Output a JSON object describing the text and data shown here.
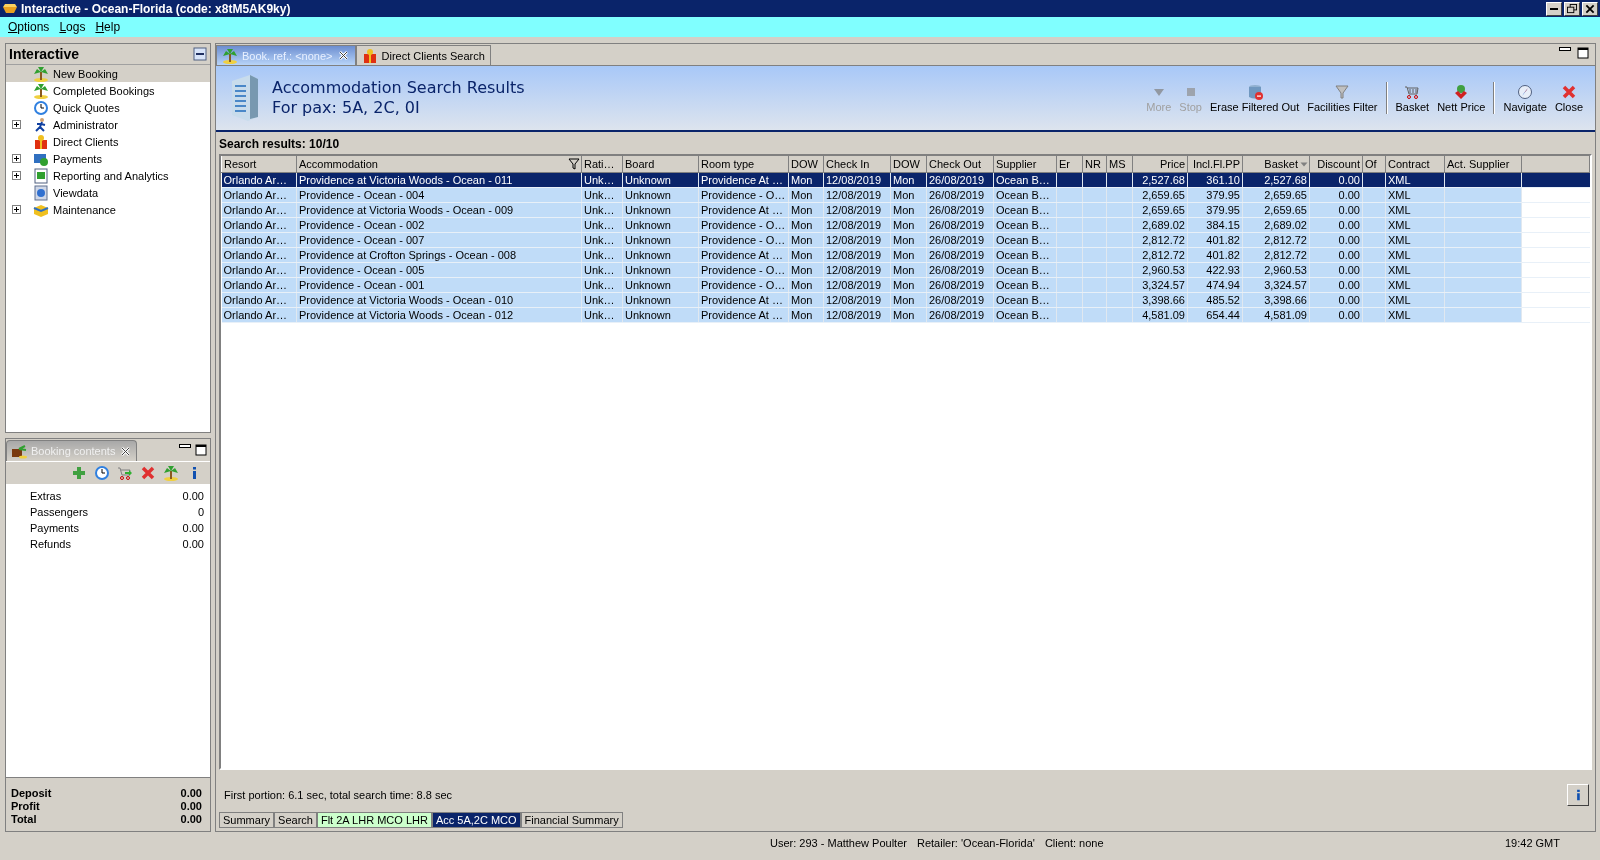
{
  "window": {
    "title": "Interactive - Ocean-Florida (code: x8tM5AK9ky)"
  },
  "menu": [
    {
      "label": "Options"
    },
    {
      "label": "Logs"
    },
    {
      "label": "Help"
    }
  ],
  "navigator": {
    "title": "Interactive",
    "items": [
      {
        "label": "New Booking",
        "selected": true,
        "expandable": false
      },
      {
        "label": "Completed Bookings",
        "selected": false,
        "expandable": false
      },
      {
        "label": "Quick Quotes",
        "selected": false,
        "expandable": false
      },
      {
        "label": "Administrator",
        "selected": false,
        "expandable": true
      },
      {
        "label": "Direct Clients",
        "selected": false,
        "expandable": false
      },
      {
        "label": "Payments",
        "selected": false,
        "expandable": true
      },
      {
        "label": "Reporting and Analytics",
        "selected": false,
        "expandable": true
      },
      {
        "label": "Viewdata",
        "selected": false,
        "expandable": false
      },
      {
        "label": "Maintenance",
        "selected": false,
        "expandable": true
      }
    ]
  },
  "booking_panel": {
    "tab": "Booking contents",
    "lines": [
      {
        "label": "Extras",
        "value": "0.00"
      },
      {
        "label": "Passengers",
        "value": "0"
      },
      {
        "label": "Payments",
        "value": "0.00"
      },
      {
        "label": "Refunds",
        "value": "0.00"
      }
    ],
    "totals": [
      {
        "label": "Deposit",
        "value": "0.00"
      },
      {
        "label": "Profit",
        "value": "0.00"
      },
      {
        "label": "Total",
        "value": "0.00"
      }
    ]
  },
  "tabs": [
    {
      "label": "Book. ref.: <none>",
      "selected": true,
      "closable": true
    },
    {
      "label": "Direct Clients Search",
      "selected": false,
      "closable": false
    }
  ],
  "header": {
    "title": "Accommodation Search Results",
    "subtitle": "For pax: 5A, 2C, 0I"
  },
  "toolbar": {
    "groups": [
      [
        {
          "label": "More",
          "disabled": true
        },
        {
          "label": "Stop",
          "disabled": true
        },
        {
          "label": "Erase Filtered Out",
          "disabled": false
        },
        {
          "label": "Facilities Filter",
          "disabled": false
        }
      ],
      [
        {
          "label": "Basket",
          "disabled": false
        },
        {
          "label": "Nett Price",
          "disabled": false
        }
      ],
      [
        {
          "label": "Navigate",
          "disabled": false
        },
        {
          "label": "Close",
          "disabled": false
        }
      ]
    ]
  },
  "results_label": "Search results: 10/10",
  "table": {
    "columns": [
      {
        "label": "Resort",
        "kind": "text",
        "filtered": false,
        "sorted": false
      },
      {
        "label": "Accommodation",
        "kind": "text",
        "filtered": true,
        "sorted": false
      },
      {
        "label": "Rati…",
        "kind": "text",
        "filtered": false,
        "sorted": false
      },
      {
        "label": "Board",
        "kind": "text",
        "filtered": false,
        "sorted": false
      },
      {
        "label": "Room type",
        "kind": "text",
        "filtered": false,
        "sorted": false
      },
      {
        "label": "DOW",
        "kind": "text",
        "filtered": false,
        "sorted": false
      },
      {
        "label": "Check In",
        "kind": "text",
        "filtered": false,
        "sorted": false
      },
      {
        "label": "DOW",
        "kind": "text",
        "filtered": false,
        "sorted": false
      },
      {
        "label": "Check Out",
        "kind": "text",
        "filtered": false,
        "sorted": false
      },
      {
        "label": "Supplier",
        "kind": "text",
        "filtered": false,
        "sorted": false
      },
      {
        "label": "Er",
        "kind": "center",
        "filtered": false,
        "sorted": false
      },
      {
        "label": "NR",
        "kind": "center",
        "filtered": false,
        "sorted": false
      },
      {
        "label": "MS",
        "kind": "center",
        "filtered": false,
        "sorted": false
      },
      {
        "label": "Price",
        "kind": "number",
        "filtered": false,
        "sorted": false
      },
      {
        "label": "Incl.Fl.PP",
        "kind": "number",
        "filtered": false,
        "sorted": false
      },
      {
        "label": "Basket",
        "kind": "number",
        "filtered": false,
        "sorted": true
      },
      {
        "label": "Discount",
        "kind": "number",
        "filtered": false,
        "sorted": false
      },
      {
        "label": "Of",
        "kind": "center",
        "filtered": false,
        "sorted": false
      },
      {
        "label": "Contract",
        "kind": "text",
        "filtered": false,
        "sorted": false
      },
      {
        "label": "Act. Supplier",
        "kind": "text",
        "filtered": false,
        "sorted": false
      }
    ],
    "rows": [
      {
        "selected": true,
        "cells": [
          "Orlando Ar…",
          "Providence at Victoria Woods - Ocean - 011",
          "Unk…",
          "Unknown",
          "Providence At …",
          "Mon",
          "12/08/2019",
          "Mon",
          "26/08/2019",
          "Ocean B…",
          null,
          null,
          null,
          "2,527.68",
          "361.10",
          "2,527.68",
          "0.00",
          null,
          "XML",
          null
        ]
      },
      {
        "selected": false,
        "cells": [
          "Orlando Ar…",
          "Providence - Ocean - 004",
          "Unk…",
          "Unknown",
          "Providence - O…",
          "Mon",
          "12/08/2019",
          "Mon",
          "26/08/2019",
          "Ocean B…",
          null,
          null,
          null,
          "2,659.65",
          "379.95",
          "2,659.65",
          "0.00",
          null,
          "XML",
          null
        ]
      },
      {
        "selected": false,
        "cells": [
          "Orlando Ar…",
          "Providence at Victoria Woods - Ocean - 009",
          "Unk…",
          "Unknown",
          "Providence At …",
          "Mon",
          "12/08/2019",
          "Mon",
          "26/08/2019",
          "Ocean B…",
          null,
          null,
          null,
          "2,659.65",
          "379.95",
          "2,659.65",
          "0.00",
          null,
          "XML",
          null
        ]
      },
      {
        "selected": false,
        "cells": [
          "Orlando Ar…",
          "Providence - Ocean - 002",
          "Unk…",
          "Unknown",
          "Providence - O…",
          "Mon",
          "12/08/2019",
          "Mon",
          "26/08/2019",
          "Ocean B…",
          null,
          null,
          null,
          "2,689.02",
          "384.15",
          "2,689.02",
          "0.00",
          null,
          "XML",
          null
        ]
      },
      {
        "selected": false,
        "cells": [
          "Orlando Ar…",
          "Providence - Ocean - 007",
          "Unk…",
          "Unknown",
          "Providence - O…",
          "Mon",
          "12/08/2019",
          "Mon",
          "26/08/2019",
          "Ocean B…",
          null,
          null,
          null,
          "2,812.72",
          "401.82",
          "2,812.72",
          "0.00",
          null,
          "XML",
          null
        ]
      },
      {
        "selected": false,
        "cells": [
          "Orlando Ar…",
          "Providence at Crofton Springs - Ocean - 008",
          "Unk…",
          "Unknown",
          "Providence At …",
          "Mon",
          "12/08/2019",
          "Mon",
          "26/08/2019",
          "Ocean B…",
          null,
          null,
          null,
          "2,812.72",
          "401.82",
          "2,812.72",
          "0.00",
          null,
          "XML",
          null
        ]
      },
      {
        "selected": false,
        "cells": [
          "Orlando Ar…",
          "Providence - Ocean - 005",
          "Unk…",
          "Unknown",
          "Providence - O…",
          "Mon",
          "12/08/2019",
          "Mon",
          "26/08/2019",
          "Ocean B…",
          null,
          null,
          null,
          "2,960.53",
          "422.93",
          "2,960.53",
          "0.00",
          null,
          "XML",
          null
        ]
      },
      {
        "selected": false,
        "cells": [
          "Orlando Ar…",
          "Providence - Ocean - 001",
          "Unk…",
          "Unknown",
          "Providence - O…",
          "Mon",
          "12/08/2019",
          "Mon",
          "26/08/2019",
          "Ocean B…",
          null,
          null,
          null,
          "3,324.57",
          "474.94",
          "3,324.57",
          "0.00",
          null,
          "XML",
          null
        ]
      },
      {
        "selected": false,
        "cells": [
          "Orlando Ar…",
          "Providence at Victoria Woods - Ocean - 010",
          "Unk…",
          "Unknown",
          "Providence At …",
          "Mon",
          "12/08/2019",
          "Mon",
          "26/08/2019",
          "Ocean B…",
          null,
          null,
          null,
          "3,398.66",
          "485.52",
          "3,398.66",
          "0.00",
          null,
          "XML",
          null
        ]
      },
      {
        "selected": false,
        "cells": [
          "Orlando Ar…",
          "Providence at Victoria Woods - Ocean - 012",
          "Unk…",
          "Unknown",
          "Providence At …",
          "Mon",
          "12/08/2019",
          "Mon",
          "26/08/2019",
          "Ocean B…",
          null,
          null,
          null,
          "4,581.09",
          "654.44",
          "4,581.09",
          "0.00",
          null,
          "XML",
          null
        ]
      }
    ]
  },
  "timing": "First portion: 6.1 sec, total search time: 8.8 sec",
  "bottom_tabs": [
    {
      "label": "Summary",
      "selected": false,
      "color": "#d4d0c8"
    },
    {
      "label": "Search",
      "selected": false,
      "color": "#d4d0c8"
    },
    {
      "label": "Flt 2A LHR MCO LHR",
      "selected": false,
      "color": "#ccffcc"
    },
    {
      "label": "Acc 5A,2C MCO",
      "selected": true,
      "color": "#0a246a"
    },
    {
      "label": "Financial Summary",
      "selected": false,
      "color": "#d4d0c8"
    }
  ],
  "status_bar": {
    "user": "User: 293 - Matthew Poulter",
    "retailer": "Retailer: 'Ocean-Florida'",
    "client": "Client: none",
    "time": "19:42 GMT"
  }
}
